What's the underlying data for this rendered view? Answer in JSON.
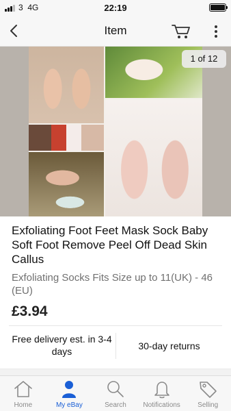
{
  "status_bar": {
    "carrier": "3",
    "network": "4G",
    "time": "22:19"
  },
  "nav": {
    "title": "Item"
  },
  "gallery": {
    "counter": "1 of 12"
  },
  "item": {
    "title": "Exfoliating Foot Feet Mask Sock Baby Soft Foot Remove Peel Off Dead Skin Callus",
    "subtitle": "Exfoliating Socks Fits Size up to 11(UK) - 46 (EU)",
    "price": "£3.94"
  },
  "shipping": {
    "delivery": "Free delivery est. in 3-4 days",
    "returns": "30-day returns"
  },
  "tabs": [
    {
      "label": "Home",
      "icon": "home-icon"
    },
    {
      "label": "My eBay",
      "icon": "person-icon",
      "active": true
    },
    {
      "label": "Search",
      "icon": "search-icon"
    },
    {
      "label": "Notifications",
      "icon": "bell-icon"
    },
    {
      "label": "Selling",
      "icon": "tag-icon"
    }
  ],
  "colors": {
    "accent": "#1a5fd6",
    "tab_inactive": "#8a8a8a",
    "subtitle": "#707070"
  }
}
